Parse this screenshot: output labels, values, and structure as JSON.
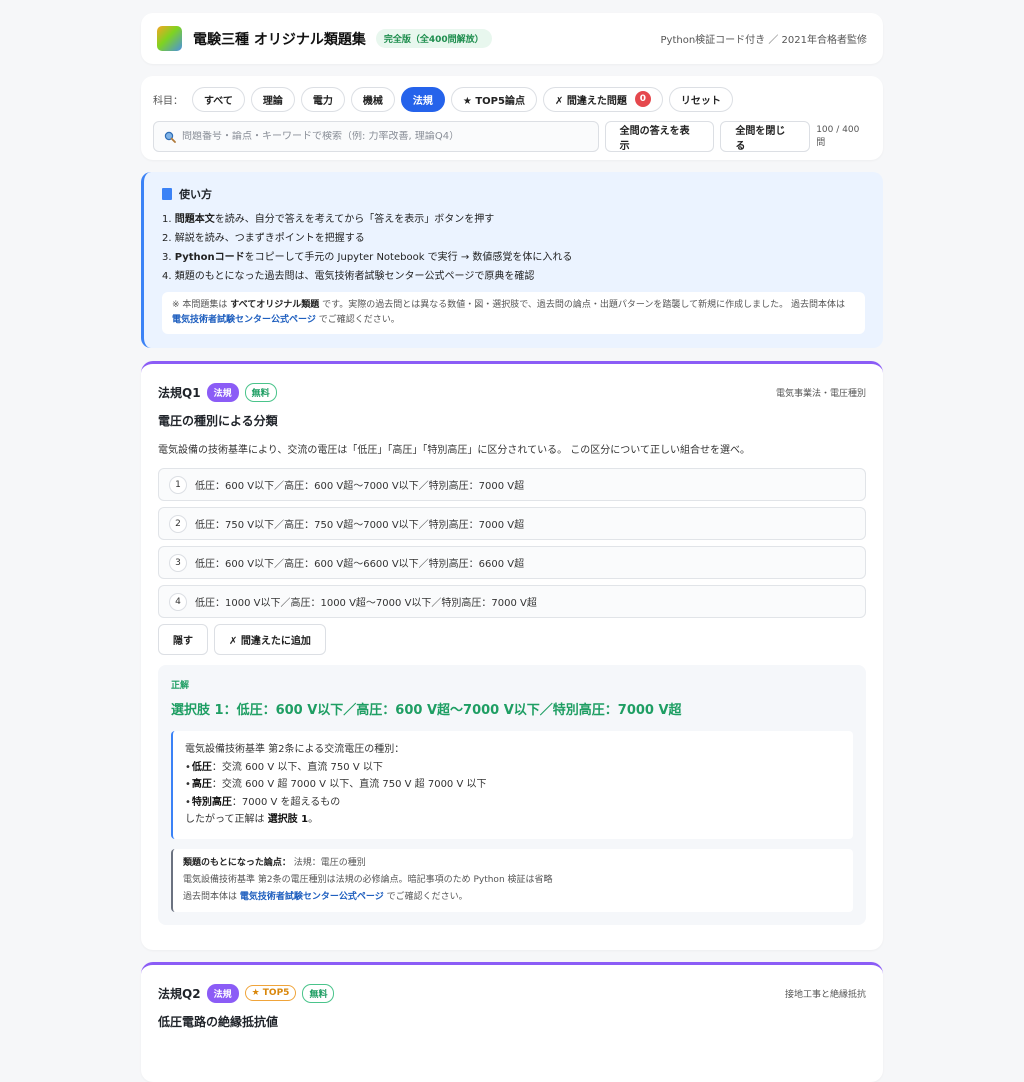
{
  "header": {
    "title": "電験三種 オリジナル類題集",
    "edition": "完全版（全400問解放）",
    "right": "Python検証コード付き ／ 2021年合格者監修"
  },
  "filter": {
    "label": "科目：",
    "chips": [
      "すべて",
      "理論",
      "電力",
      "機械",
      "法規",
      "★ TOP5論点",
      "✗ 間違えた問題"
    ],
    "wrong_count": "0",
    "reset": "リセット",
    "search_placeholder": "問題番号・論点・キーワードで検索（例: 力率改善, 理論Q4）",
    "show_all": "全問の答えを表示",
    "close_all": "全問を閉じる",
    "counter": "100 / 400 問"
  },
  "usage": {
    "title": "使い方",
    "steps": [
      [
        "1. ",
        "問題本文",
        "を読み、自分で答えを考えてから「答えを表示」ボタンを押す"
      ],
      [
        "2. 解説を読み、つまずきポイントを把握する"
      ],
      [
        "3. ",
        "Pythonコード",
        "をコピーして手元の Jupyter Notebook で実行 → 数値感覚を体に入れる"
      ],
      [
        "4. 類題のもとになった過去問は、電気技術者試験センター公式ページで原典を確認"
      ]
    ],
    "note_pre": "※ 本問題集は ",
    "note_bold": "すべてオリジナル類題",
    "note_mid": " です。実際の過去問とは異なる数値・図・選択肢で、過去問の論点・出題パターンを踏襲して新規に作成しました。 過去問本体は ",
    "note_link": "電気技術者試験センター公式ページ",
    "note_post": " でご確認ください。"
  },
  "q1": {
    "no": "法規Q1",
    "badge_subject": "法規",
    "badge_free": "無料",
    "tag": "電気事業法・電圧種別",
    "title": "電圧の種別による分類",
    "body": "電気設備の技術基準により、交流の電圧は「低圧」「高圧」「特別高圧」に区分されている。 この区分について正しい組合せを選べ。",
    "choices": [
      {
        "n": "1",
        "text": "低圧：600 V以下／高圧：600 V超〜7000 V以下／特別高圧：7000 V超"
      },
      {
        "n": "2",
        "text": "低圧：750 V以下／高圧：750 V超〜7000 V以下／特別高圧：7000 V超"
      },
      {
        "n": "3",
        "text": "低圧：600 V以下／高圧：600 V超〜6600 V以下／特別高圧：6600 V超"
      },
      {
        "n": "4",
        "text": "低圧：1000 V以下／高圧：1000 V超〜7000 V以下／特別高圧：7000 V超"
      }
    ],
    "hide": "隠す",
    "add_wrong": "✗ 間違えたに追加",
    "answer_label": "正解",
    "answer": "選択肢 1：低圧：600 V以下／高圧：600 V超〜7000 V以下／特別高圧：7000 V超",
    "explain_intro": "電気設備技術基準 第2条による交流電圧の種別：",
    "explain_items": [
      {
        "k": "低圧",
        "v": "：交流 600 V 以下、直流 750 V 以下"
      },
      {
        "k": "高圧",
        "v": "：交流 600 V 超 7000 V 以下、直流 750 V 超 7000 V 以下"
      },
      {
        "k": "特別高圧",
        "v": "：7000 V を超えるもの"
      }
    ],
    "explain_conclusion_pre": "したがって正解は ",
    "explain_conclusion_bold": "選択肢 1",
    "explain_conclusion_post": "。",
    "basis_label": "類題のもとになった論点：",
    "basis_topic": " 法規：電圧の種別",
    "basis_line2": "電気設備技術基準 第2条の電圧種別は法規の必修論点。暗記事項のため Python 検証は省略",
    "basis_line3_pre": "過去問本体は ",
    "basis_link": "電気技術者試験センター公式ページ",
    "basis_line3_post": " でご確認ください。"
  },
  "q2": {
    "no": "法規Q2",
    "badge_subject": "法規",
    "badge_top": "★ TOP5",
    "badge_free": "無料",
    "tag": "接地工事と絶縁抵抗",
    "title": "低圧電路の絶縁抵抗値"
  },
  "colors": {
    "accent": "#2563eb",
    "law": "#8b5cf6",
    "correct": "#1e9e63",
    "wrong_badge": "#e5484d"
  }
}
